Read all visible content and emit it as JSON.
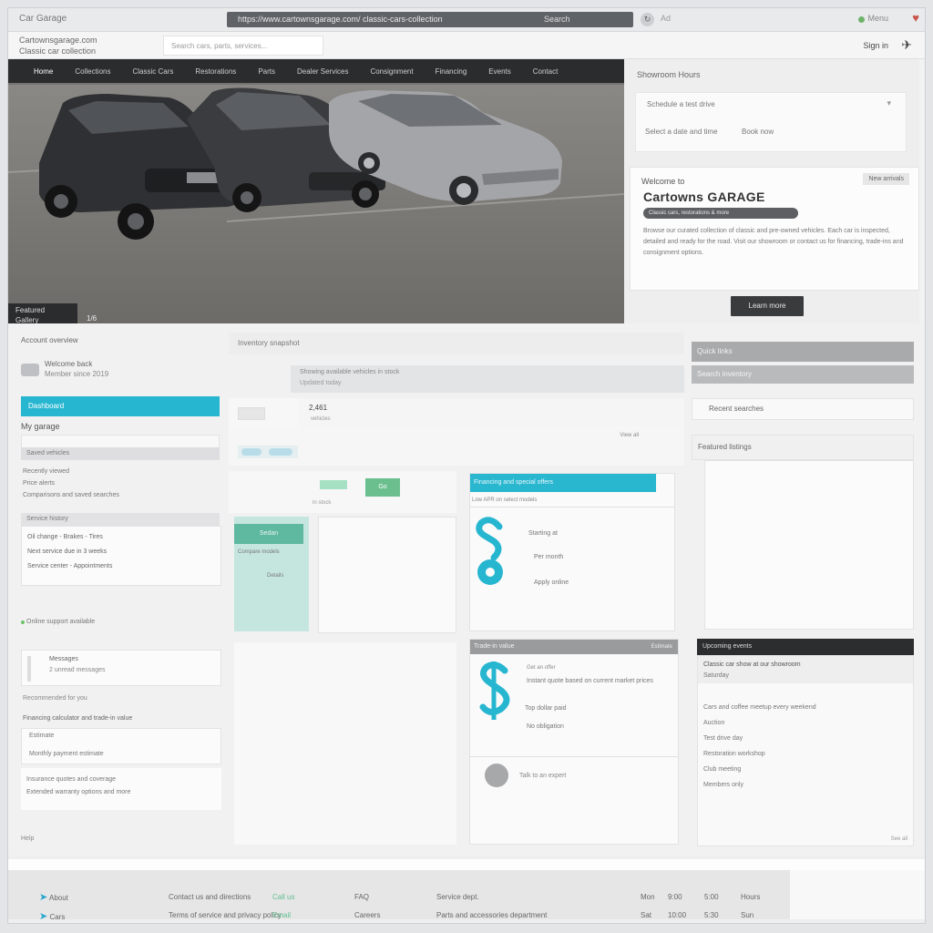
{
  "browser": {
    "tab_title": "Car Garage",
    "url": "https://www.cartownsgarage.com/ classic-cars-collection",
    "url_right": "Search",
    "extension": "Ad",
    "right_label": "Menu",
    "sub_line1": "Cartownsgarage.com",
    "sub_line2": "Classic car collection",
    "search_placeholder": "Search cars, parts, services...",
    "user_label": "Sign in"
  },
  "hero": {
    "nav": [
      "Home",
      "Collections",
      "Classic Cars",
      "Restorations",
      "Parts",
      "Dealer Services",
      "Consignment",
      "Financing",
      "Events",
      "Contact"
    ],
    "caption_line1": "Featured",
    "caption_line2": "Gallery",
    "caption2": "1/6"
  },
  "promo": {
    "heading": "Showroom Hours",
    "box_title": "Schedule a test drive",
    "box_chevron": "▾",
    "box_left": "Select a date and time",
    "box_right": "Book now",
    "kicker": "Welcome to",
    "tag": "New arrivals",
    "title": "Cartowns GARAGE",
    "pill": "Classic cars, restorations & more",
    "para": "Browse our curated collection of classic and pre-owned vehicles. Each car is inspected, detailed and ready for the road. Visit our showroom or contact us for financing, trade-ins and consignment options.",
    "button": "Learn more"
  },
  "left": {
    "title": "Account overview",
    "user_name": "Welcome back",
    "user_sub": "Member since 2019",
    "cyan_bar": "Dashboard",
    "section_label": "My garage",
    "grey1": "Saved vehicles",
    "lines": [
      "Recently viewed",
      "Price alerts",
      "Comparisons and saved searches"
    ],
    "grey2": "Service history",
    "panel1": [
      "Oil change - Brakes - Tires",
      "Next service due in 3 weeks",
      "Service center - Appointments"
    ],
    "status": "Online support available",
    "panel2_a": "Messages",
    "panel2_b": "2 unread messages",
    "l3": "Recommended for you",
    "l4": "Financing calculator and trade-in value",
    "panel3_a": "Estimate",
    "panel3_b": "Monthly payment estimate",
    "panel4": [
      "Insurance quotes and coverage",
      "Extended warranty options and more"
    ],
    "foot": "Help"
  },
  "center": {
    "header": "Inventory snapshot",
    "strip_a": "Showing available vehicles in stock",
    "strip_b": "Updated today",
    "stat_value": "2,461",
    "stat_sub": "vehicles",
    "subhdr_right": "View all",
    "green_btn": "Go",
    "row2_sub": "in stock",
    "mint_head": "Sedan",
    "mint_a": "Compare models",
    "mint_b": "Details",
    "cyan_head": "Financing and special offers",
    "cyan_sub": "Low APR on select models",
    "cyan_r1": "Starting at",
    "cyan_r2": "Per month",
    "cyan_r3": "Apply online",
    "gray_head": "Trade-in value",
    "gray_head_right": "Estimate",
    "gray_a": "Get an offer",
    "gray_b": "Instant quote based on current market prices",
    "gray_c": "Top dollar paid",
    "gray_d": "No obligation",
    "gray_e": "Talk to an expert"
  },
  "right": {
    "g1": "Quick links",
    "g2": "Search inventory",
    "box1": "Recent searches",
    "box2": "Featured listings",
    "dark": "Upcoming events",
    "panel_a": "Classic car show at our showroom",
    "panel_b": "Saturday",
    "list": [
      "Cars and coffee meetup every weekend",
      "Auction",
      "Test drive day",
      "Restoration workshop",
      "Club meeting"
    ],
    "list_more": "Members only",
    "foot": "See all"
  },
  "footer": {
    "c1": [
      "About",
      "Cars"
    ],
    "c2": [
      "Contact us and directions",
      "Terms of service and privacy policy"
    ],
    "c3": [
      "Call us",
      "Email"
    ],
    "c4": [
      "FAQ",
      "Careers"
    ],
    "c5": [
      "Service dept.",
      "Parts and accessories department"
    ],
    "c6": [
      "Mon",
      "Sat"
    ],
    "c7": [
      "9:00",
      "10:00"
    ],
    "c8": [
      "5:00",
      "5:30"
    ],
    "c9": [
      "Hours",
      "Sun"
    ]
  },
  "colors": {
    "accent": "#27b6d0",
    "dark": "#2b2c2e",
    "mint": "#5fb8a0"
  }
}
